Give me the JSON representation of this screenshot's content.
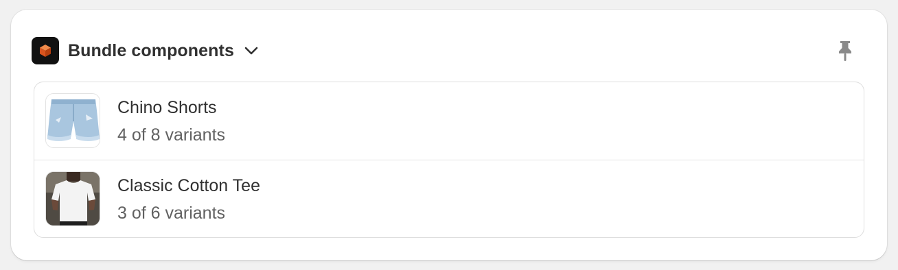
{
  "card": {
    "title": "Bundle components",
    "icons": {
      "app": "cube-app-icon",
      "toggle": "chevron-down-icon",
      "pin": "pin-icon"
    }
  },
  "components": [
    {
      "name": "Chino Shorts",
      "variants": "4 of 8 variants",
      "image": "denim-shorts-thumbnail"
    },
    {
      "name": "Classic Cotton Tee",
      "variants": "3 of 6 variants",
      "image": "white-tee-thumbnail"
    }
  ],
  "colors": {
    "accent": "#e8622c",
    "text_primary": "#303030",
    "text_secondary": "#616161"
  }
}
